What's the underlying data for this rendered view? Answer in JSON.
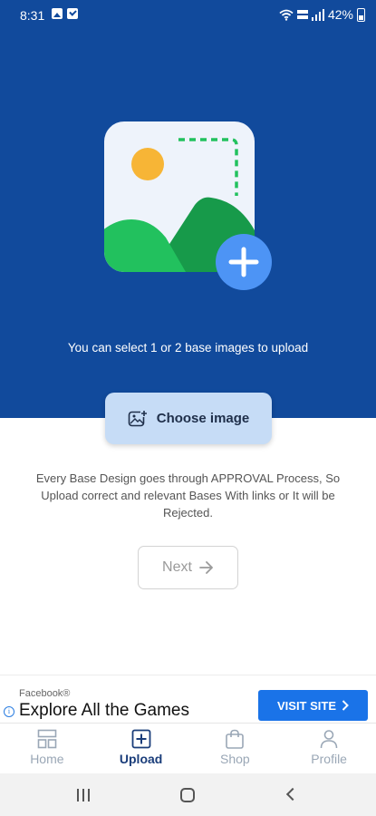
{
  "status_bar": {
    "time": "8:31",
    "battery": "42%",
    "icons": [
      "gallery-icon",
      "check-icon",
      "wifi-icon",
      "volte-icon",
      "signal-icon",
      "battery-icon"
    ]
  },
  "hero": {
    "text": "You can select 1 or 2 base images to upload"
  },
  "choose_button": {
    "label": "Choose image",
    "icon": "add-image-icon"
  },
  "notice": "Every Base Design goes through APPROVAL Process, So Upload correct and relevant Bases With links or It will be Rejected.",
  "next_button": {
    "label": "Next",
    "icon": "arrow-right-icon"
  },
  "ad": {
    "sponsor": "Facebook®",
    "headline": "Explore All the Games",
    "cta": "VISIT SITE",
    "info_symbol": "i"
  },
  "bottom_nav": {
    "items": [
      {
        "label": "Home",
        "active": false
      },
      {
        "label": "Upload",
        "active": true
      },
      {
        "label": "Shop",
        "active": false
      },
      {
        "label": "Profile",
        "active": false
      }
    ]
  },
  "colors": {
    "hero_bg": "#114a9c",
    "choose_btn_bg": "#c6dcf6",
    "accent_blue": "#1a73e8",
    "nav_active": "#1a3d7a",
    "nav_inactive": "#9aa7b6"
  }
}
